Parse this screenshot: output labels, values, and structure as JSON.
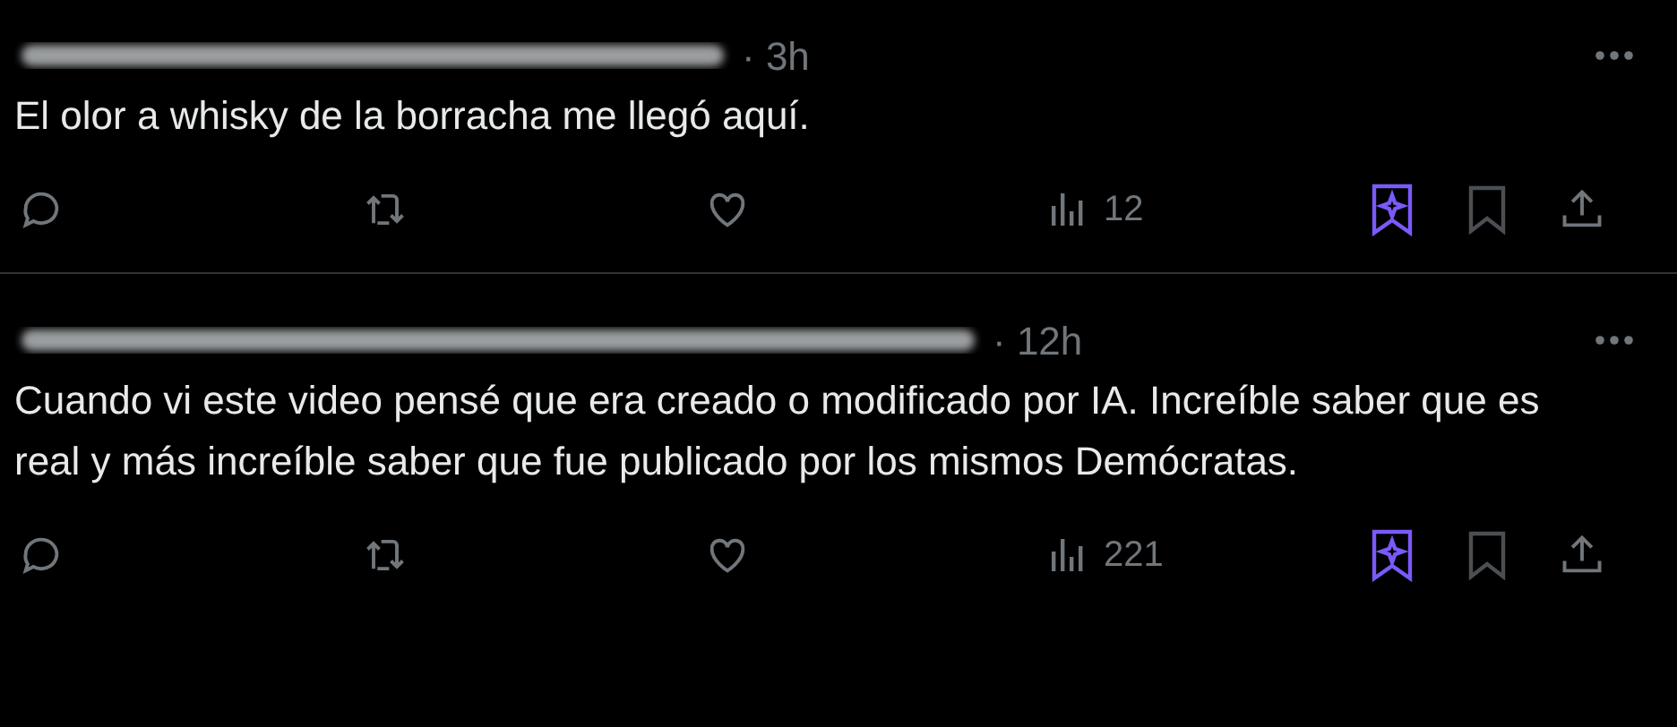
{
  "posts": [
    {
      "time": "· 3h",
      "text": "El olor a whisky de la borracha me llegó aquí.",
      "views": "12"
    },
    {
      "time": "· 12h",
      "text": "Cuando vi este video pensé que era creado o modificado por IA. Increíble saber que es real y más increíble saber que fue publicado por los mismos Demócratas.",
      "views": "221"
    }
  ]
}
